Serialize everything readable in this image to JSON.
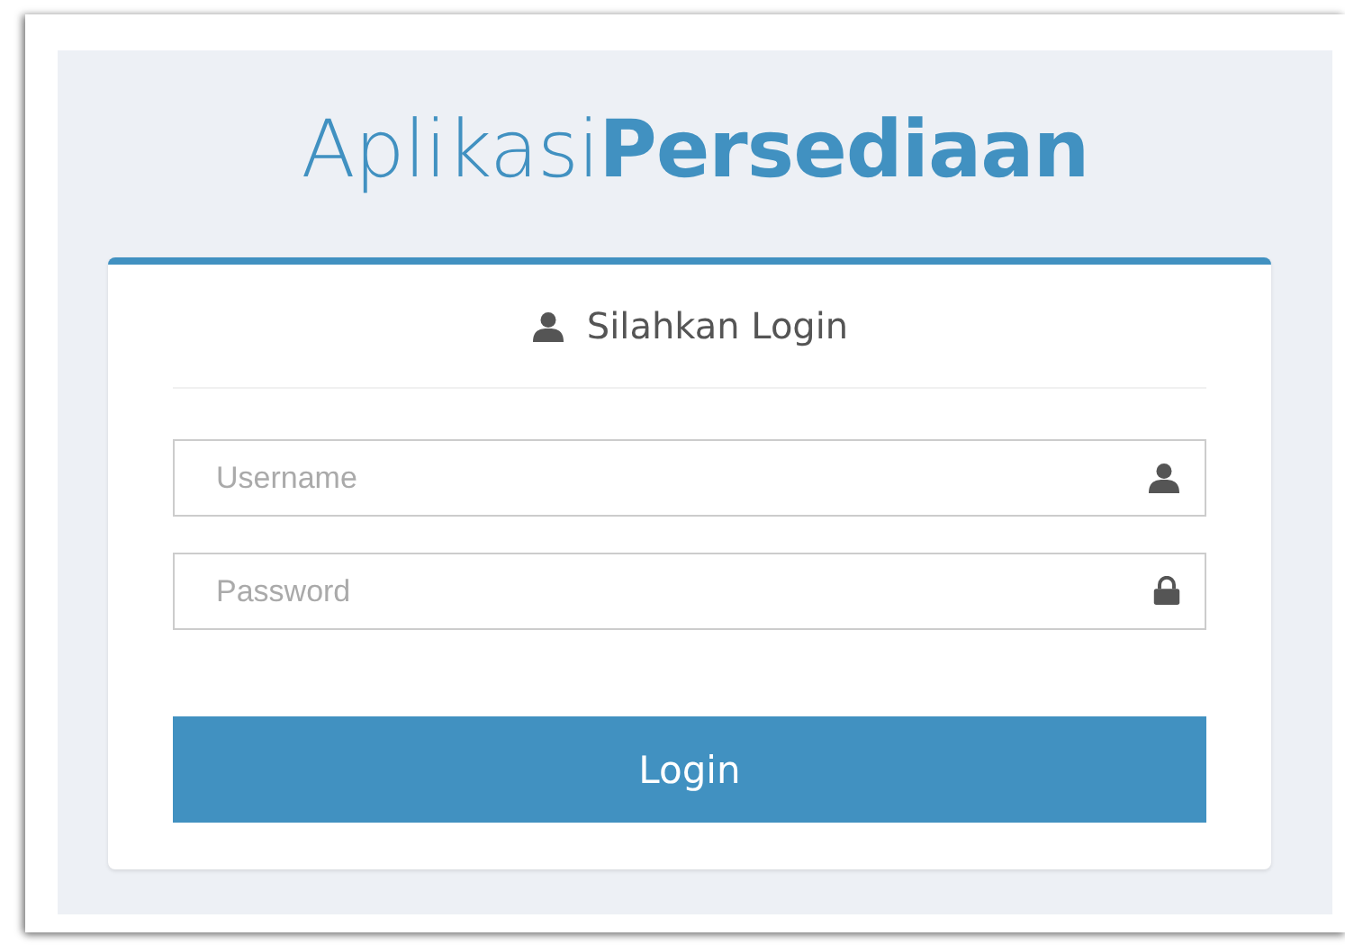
{
  "app_title": "Aplikasi**Persediaan**",
  "login_panel": {
    "heading": "Silahkan Login",
    "fields": [
      {
        "kind": "text",
        "placeholder": "Username"
      },
      {
        "kind": "password",
        "placeholder": "Password"
      }
    ],
    "submit": "Login"
  }
}
